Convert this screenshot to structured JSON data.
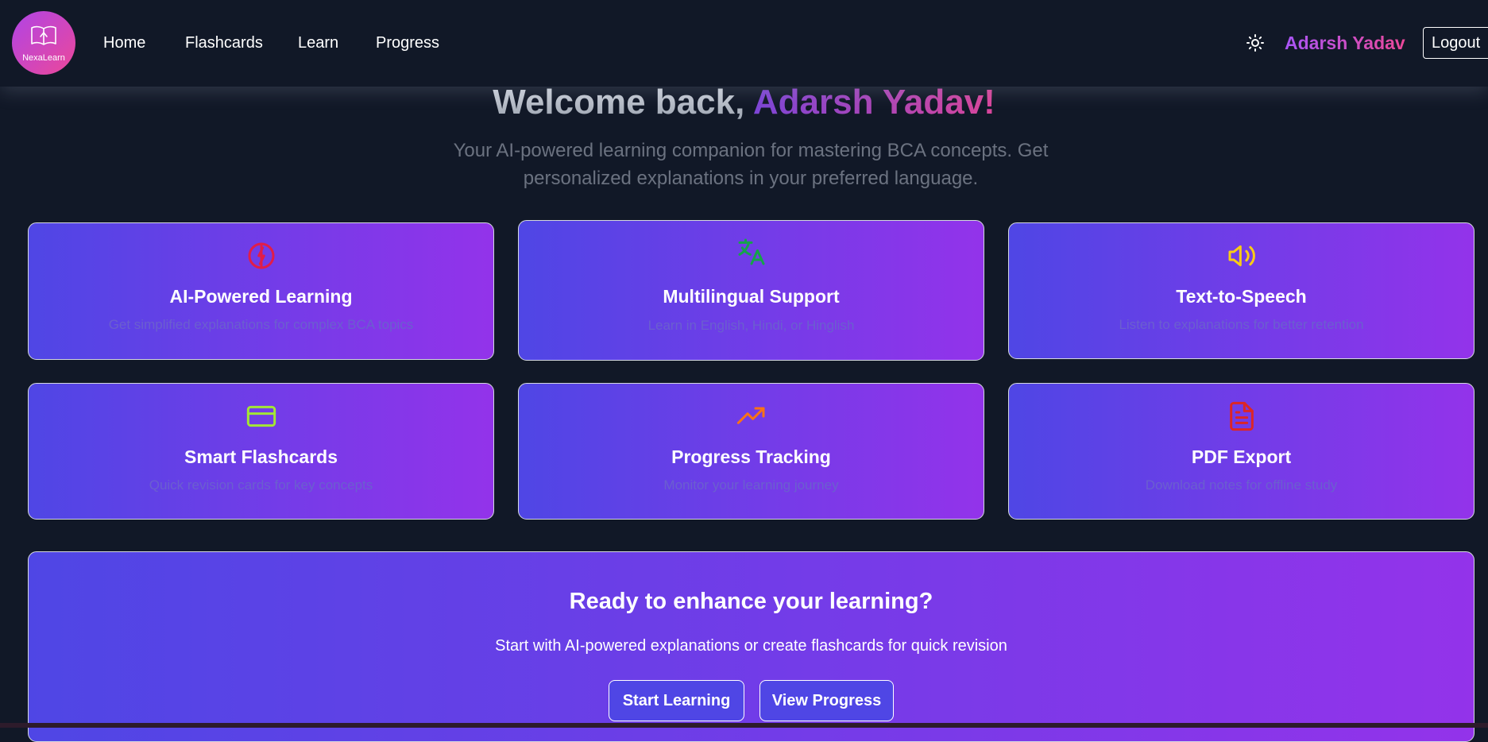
{
  "app": {
    "logo_text": "NexaLearn",
    "user_name": "Adarsh Yadav",
    "logout_label": "Logout"
  },
  "nav": {
    "items": [
      {
        "label": "Home"
      },
      {
        "label": "Flashcards"
      },
      {
        "label": "Learn"
      },
      {
        "label": "Progress"
      }
    ]
  },
  "hero": {
    "welcome_prefix": "Welcome back, ",
    "welcome_name": "Adarsh Yadav!",
    "subtitle": "Your AI-powered learning companion for mastering BCA concepts. Get personalized explanations in your preferred language."
  },
  "features": [
    {
      "icon": "brain-icon",
      "icon_color": "#e11d48",
      "title": "AI-Powered Learning",
      "desc": "Get simplified explanations for complex BCA topics"
    },
    {
      "icon": "languages-icon",
      "icon_color": "#16a34a",
      "title": "Multilingual Support",
      "desc": "Learn in English, Hindi, or Hinglish"
    },
    {
      "icon": "speaker-icon",
      "icon_color": "#facc15",
      "title": "Text-to-Speech",
      "desc": "Listen to explanations for better retention"
    },
    {
      "icon": "credit-card-icon",
      "icon_color": "#a3e635",
      "title": "Smart Flashcards",
      "desc": "Quick revision cards for key concepts"
    },
    {
      "icon": "trending-up-icon",
      "icon_color": "#f97316",
      "title": "Progress Tracking",
      "desc": "Monitor your learning journey"
    },
    {
      "icon": "file-text-icon",
      "icon_color": "#dc2626",
      "title": "PDF Export",
      "desc": "Download notes for offline study"
    }
  ],
  "cta": {
    "title": "Ready to enhance your learning?",
    "text": "Start with AI-powered explanations or create flashcards for quick revision",
    "primary_label": "Start Learning",
    "secondary_label": "View Progress"
  },
  "colors": {
    "page_bg": "#111827",
    "card_gradient_start": "#4f46e5",
    "card_gradient_end": "#9333ea",
    "accent_purple": "#a855f7",
    "accent_pink": "#ec4899"
  }
}
